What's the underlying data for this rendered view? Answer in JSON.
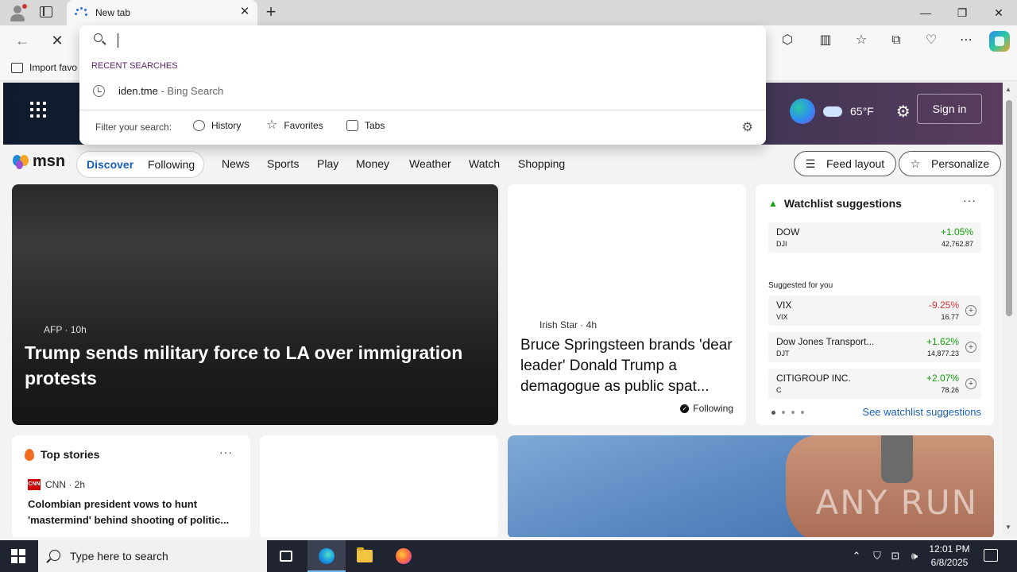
{
  "browser": {
    "tab_title": "New tab",
    "favorites_import": "Import favo",
    "icons": [
      "profile-icon",
      "tab-actions-icon",
      "loading-spinner-icon",
      "close-icon",
      "plus-icon",
      "minimize-icon",
      "restore-icon",
      "close-window-icon",
      "back-icon",
      "stop-icon",
      "extensions-icon",
      "split-screen-icon",
      "favorites-star-icon",
      "collections-icon",
      "browser-essentials-icon",
      "more-icon",
      "copilot-icon"
    ]
  },
  "omnibox": {
    "value": "",
    "recent_label": "RECENT SEARCHES",
    "recent": [
      {
        "query": "iden.tme",
        "source": " - Bing Search"
      }
    ],
    "filter_label": "Filter your search:",
    "filters": [
      "History",
      "Favorites",
      "Tabs"
    ]
  },
  "msn": {
    "temperature": "65°F",
    "sign_in": "Sign in",
    "logo": "msn",
    "pills": [
      "Discover",
      "Following"
    ],
    "nav": [
      "News",
      "Sports",
      "Play",
      "Money",
      "Weather",
      "Watch",
      "Shopping"
    ],
    "feed_layout": "Feed layout",
    "personalize": "Personalize",
    "hero": {
      "source": "AFP · 10h",
      "title": "Trump sends military force to LA over immigration protests"
    },
    "card2": {
      "source": "Irish Star · 4h",
      "title": "Bruce Springsteen brands 'dear leader' Donald Trump a demagogue as public spat...",
      "following": "Following"
    },
    "watchlist": {
      "title": "Watchlist suggestions",
      "main": {
        "name": "DOW",
        "symbol": "DJI",
        "change": "+1.05%",
        "value": "42,762.87"
      },
      "suggested_label": "Suggested for you",
      "rows": [
        {
          "name": "VIX",
          "symbol": "VIX",
          "change": "-9.25%",
          "value": "16.77"
        },
        {
          "name": "Dow Jones Transport...",
          "symbol": "DJT",
          "change": "+1.62%",
          "value": "14,877.23"
        },
        {
          "name": "CITIGROUP INC.",
          "symbol": "C",
          "change": "+2.07%",
          "value": "78.26"
        }
      ],
      "see_all": "See watchlist suggestions",
      "colors": {
        "up": "#13a10e",
        "down": "#d13438"
      }
    },
    "top_stories": {
      "title": "Top stories",
      "source": "CNN · 2h",
      "logo": "CNN",
      "headline": "Colombian president vows to hunt 'mastermind' behind shooting of politic..."
    },
    "watermark": "ANY RUN"
  },
  "taskbar": {
    "search_placeholder": "Type here to search",
    "time": "12:01 PM",
    "date": "6/8/2025"
  }
}
